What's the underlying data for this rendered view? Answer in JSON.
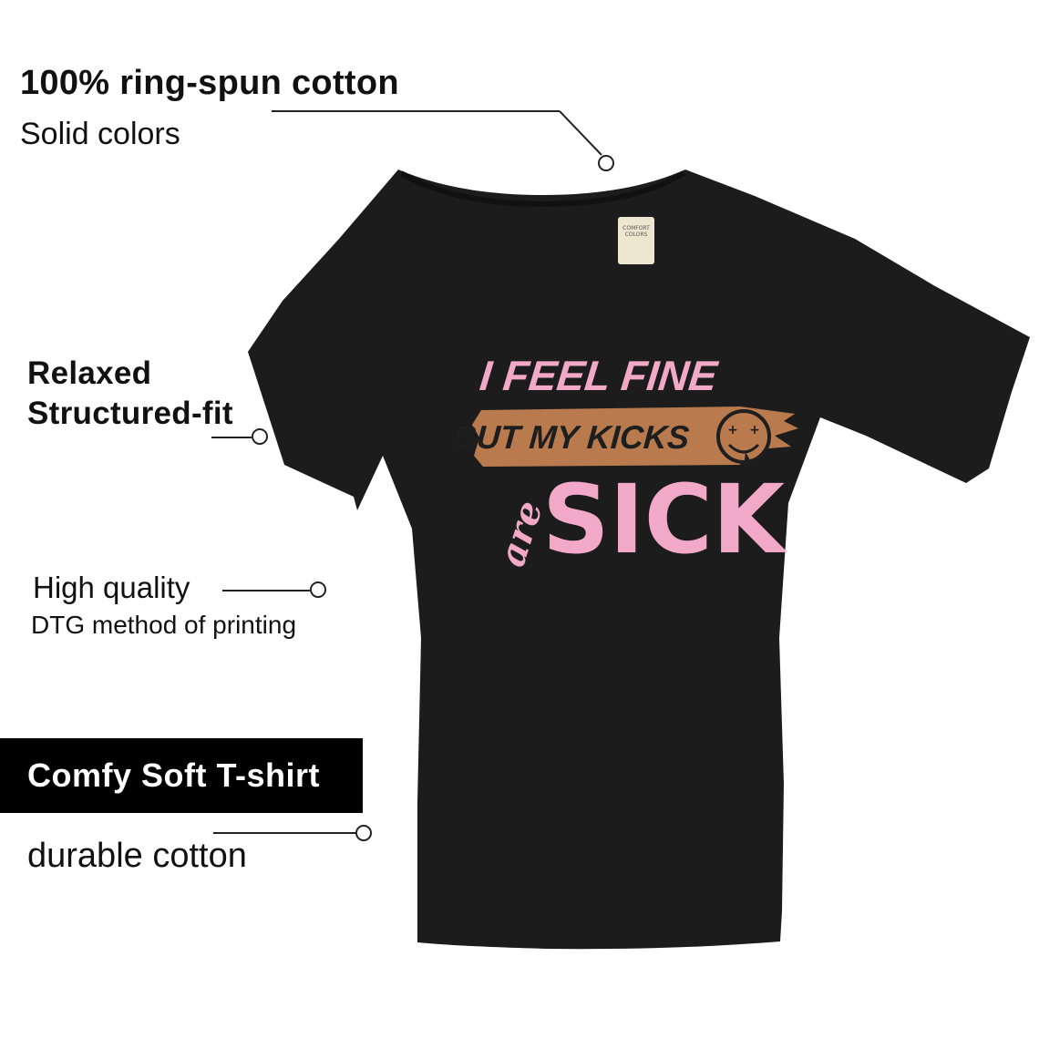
{
  "features": {
    "cotton_title": "100% ring-spun cotton",
    "cotton_sub": "Solid colors",
    "fit_title_line1": "Relaxed",
    "fit_title_line2": "Structured-fit",
    "quality_line1": "High quality",
    "quality_line2": "DTG method of printing",
    "durable": "durable cotton"
  },
  "banner": {
    "label": "Comfy Soft T-shirt"
  },
  "print": {
    "line1": "I FEEL FINE",
    "line2": "BUT MY KICKS",
    "script_word": "are",
    "big_word": "SICK"
  },
  "label_tag": {
    "line1": "COMFORT",
    "line2": "COLORS"
  },
  "colors": {
    "shirt": "#1c1c1d",
    "print_pink": "#f2a9c8",
    "brush_tan": "#b97b4e",
    "print_dark": "#1e1e1e",
    "tag": "#efe6cf"
  }
}
